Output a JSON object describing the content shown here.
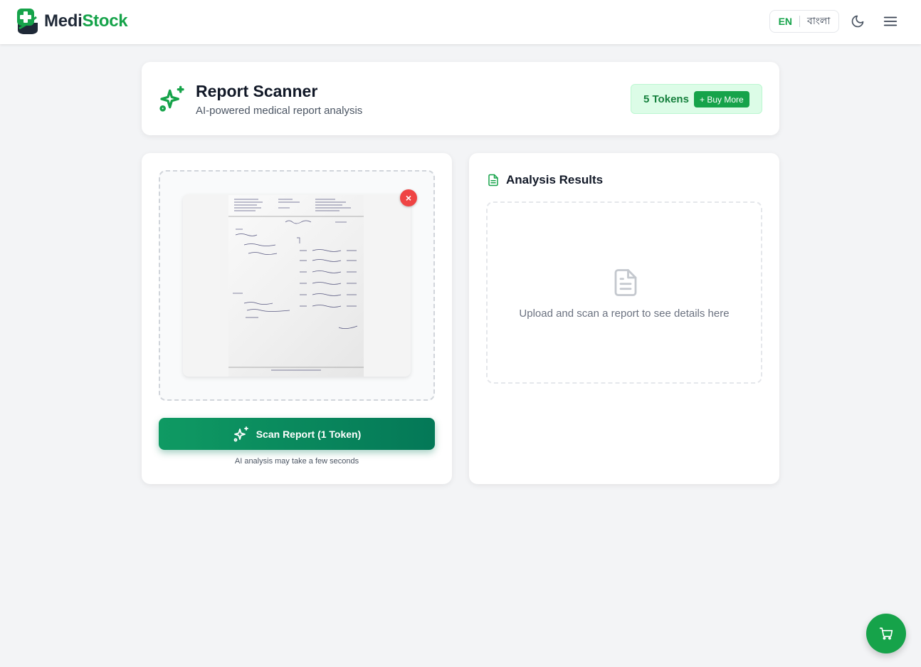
{
  "app": {
    "brand_part1": "Medi",
    "brand_part2": "Stock",
    "brand_color": "#16a34a"
  },
  "header": {
    "lang_en": "EN",
    "lang_bn": "বাংলা",
    "theme_icon": "moon-icon",
    "menu_icon": "hamburger-menu-icon"
  },
  "scanner": {
    "title": "Report Scanner",
    "subtitle": "AI-powered medical report analysis",
    "tokens_label": "5 Tokens",
    "buy_more_label": "+ Buy More",
    "icon": "sparkles-icon"
  },
  "upload": {
    "remove_label": "×",
    "scan_button_label": "Scan Report (1 Token)",
    "scan_note": "AI analysis may take a few seconds"
  },
  "results": {
    "title": "Analysis Results",
    "empty_text": "Upload and scan a report to see details here",
    "icon": "document-icon"
  },
  "fab": {
    "icon": "cart-icon"
  }
}
